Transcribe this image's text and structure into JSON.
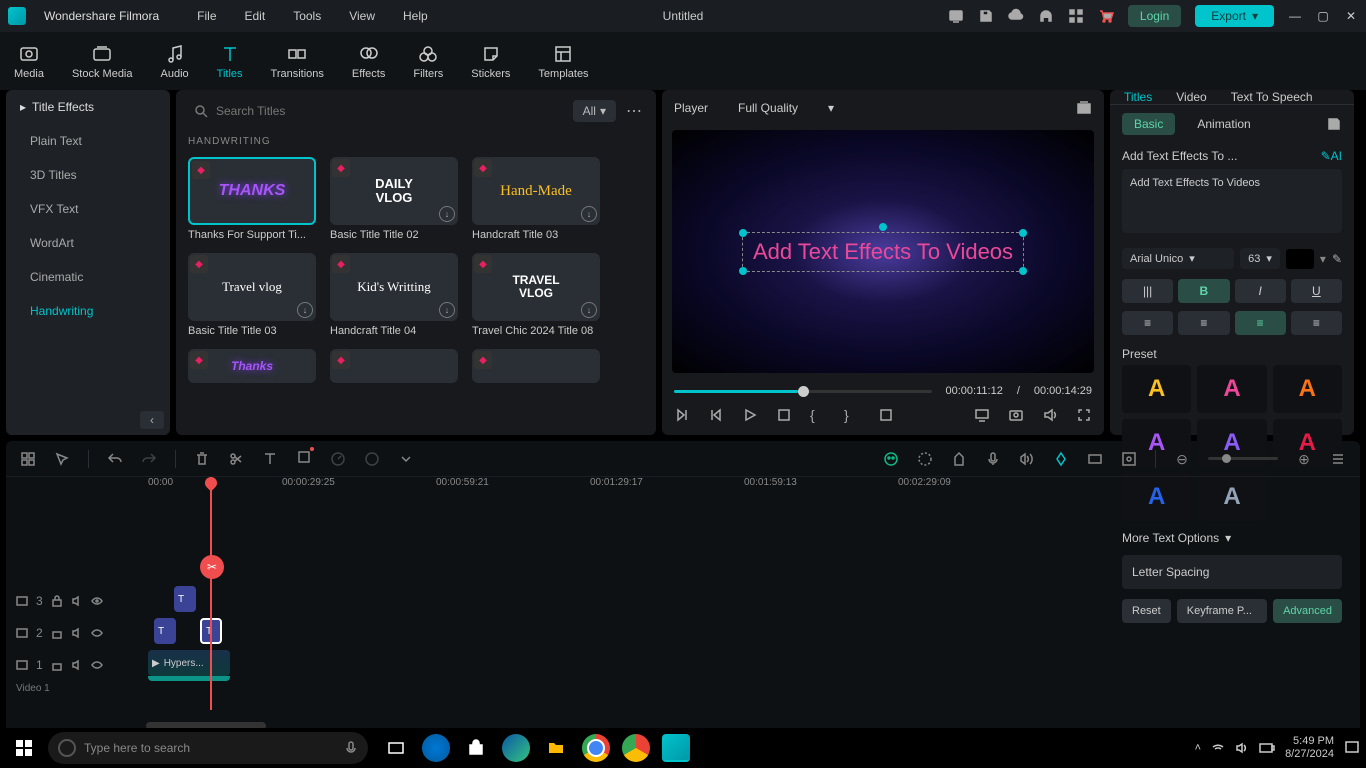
{
  "app_name": "Wondershare Filmora",
  "document_title": "Untitled",
  "menubar": [
    "File",
    "Edit",
    "Tools",
    "View",
    "Help"
  ],
  "login_label": "Login",
  "export_label": "Export",
  "main_tabs": [
    "Media",
    "Stock Media",
    "Audio",
    "Titles",
    "Transitions",
    "Effects",
    "Filters",
    "Stickers",
    "Templates"
  ],
  "active_main_tab": "Titles",
  "sidebar": {
    "header": "Title Effects",
    "items": [
      "Plain Text",
      "3D Titles",
      "VFX Text",
      "WordArt",
      "Cinematic",
      "Handwriting"
    ],
    "active": "Handwriting"
  },
  "browser": {
    "search_placeholder": "Search Titles",
    "filter_label": "All",
    "section": "HANDWRITING",
    "cards": [
      {
        "label": "Thanks For Support Ti...",
        "thumb_text": "THANKS",
        "klass": "th-thanks",
        "selected": true,
        "dl": false
      },
      {
        "label": "Basic Title Title 02",
        "thumb_text": "DAILY\nVLOG",
        "klass": "th-daily",
        "selected": false,
        "dl": true
      },
      {
        "label": "Handcraft Title 03",
        "thumb_text": "Hand-Made",
        "klass": "th-hand",
        "selected": false,
        "dl": true
      },
      {
        "label": "Basic Title Title 03",
        "thumb_text": "Travel vlog",
        "klass": "th-travel",
        "selected": false,
        "dl": true
      },
      {
        "label": "Handcraft Title 04",
        "thumb_text": "Kid's Writting",
        "klass": "th-kid",
        "selected": false,
        "dl": true
      },
      {
        "label": "Travel Chic 2024 Title 08",
        "thumb_text": "TRAVEL\nVLOG",
        "klass": "th-tchic",
        "selected": false,
        "dl": true
      }
    ]
  },
  "player": {
    "label": "Player",
    "quality": "Full Quality",
    "overlay_text": "Add Text Effects To Videos",
    "current_time": "00:00:11:12",
    "duration": "00:00:14:29"
  },
  "inspector": {
    "tabs": [
      "Titles",
      "Video",
      "Text To Speech"
    ],
    "active_tab": "Titles",
    "subtabs": [
      "Basic",
      "Animation"
    ],
    "active_subtab": "Basic",
    "text_label": "Add Text Effects To ...",
    "text_value": "Add Text Effects To Videos",
    "font_family": "Arial Unico",
    "font_size": "63",
    "preset_label": "Preset",
    "preset_colors": [
      "#fbbf24",
      "#ec4899",
      "#f97316",
      "#a855f7",
      "#8b5cf6",
      "#e11d48",
      "#2563eb",
      "#94a3b8"
    ],
    "more_options": "More Text Options",
    "letter_spacing": "Letter Spacing",
    "buttons": {
      "reset": "Reset",
      "keyframe": "Keyframe P...",
      "advanced": "Advanced"
    }
  },
  "timeline": {
    "ruler": [
      "00:00",
      "00:00:29:25",
      "00:00:59:21",
      "00:01:29:17",
      "00:01:59:13",
      "00:02:29:09"
    ],
    "tracks": [
      {
        "id": 3,
        "type": "T"
      },
      {
        "id": 2,
        "type": "T"
      },
      {
        "id": 1,
        "type": "V"
      }
    ],
    "video_track_label": "Video 1",
    "clip_label": "Hypers..."
  },
  "taskbar": {
    "search_placeholder": "Type here to search",
    "time": "5:49 PM",
    "date": "8/27/2024"
  }
}
